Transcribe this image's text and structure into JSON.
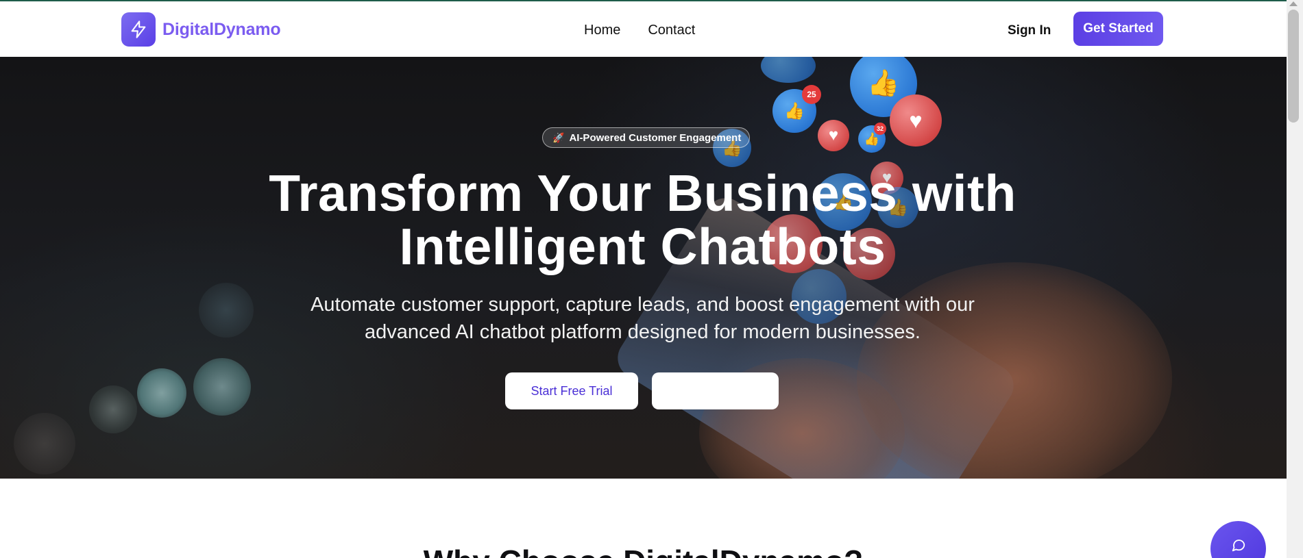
{
  "header": {
    "brand_name": "DigitalDynamo",
    "brand_icon": "lightning-bolt-icon",
    "nav": [
      {
        "label": "Home"
      },
      {
        "label": "Contact"
      }
    ],
    "sign_in_label": "Sign In",
    "get_started_label": "Get Started"
  },
  "hero": {
    "pill_icon": "🚀",
    "pill_text": "AI-Powered Customer Engagement",
    "title": "Transform Your Business with Intelligent Chatbots",
    "subtitle": "Automate customer support, capture leads, and boost engagement with our advanced AI chatbot platform designed for modern businesses.",
    "primary_cta": "Start Free Trial",
    "secondary_cta": "",
    "badge_counts": [
      "25",
      "32"
    ]
  },
  "section": {
    "heading": "Why Choose DigitalDynamo?"
  },
  "chat_widget": {
    "icon": "chat-bubble-icon"
  },
  "colors": {
    "brand": "#5b3fe4",
    "brand_text": "#7b5cf0",
    "accent_border": "#1e5c4a"
  }
}
